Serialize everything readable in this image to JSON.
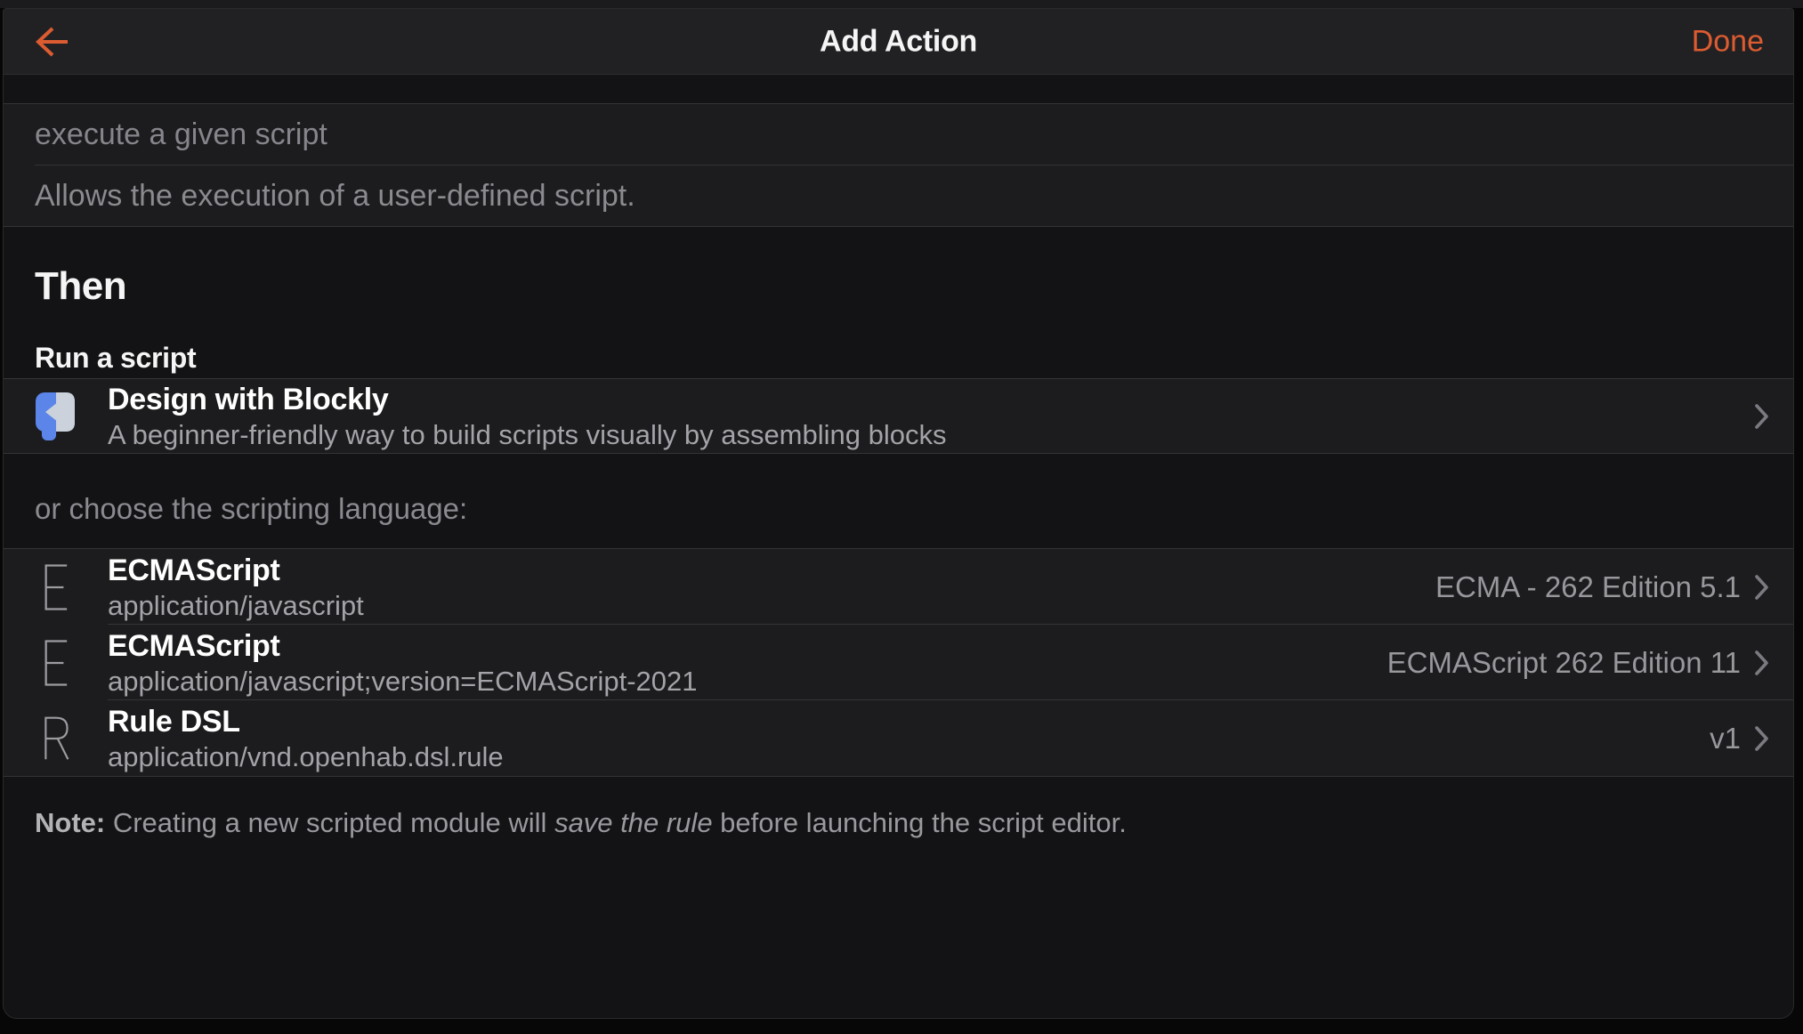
{
  "colors": {
    "accent": "#dc5c31",
    "popup_background": "#131315",
    "row_background": "#1c1c1e",
    "navbar_background": "#212123",
    "blockly_blue": "#5b85e8",
    "blockly_gray": "#ccd2db"
  },
  "navbar": {
    "title": "Add Action",
    "back_icon": "back-arrow",
    "done_label": "Done"
  },
  "search": {
    "query": "execute a given script",
    "description": "Allows the execution of a user-defined script."
  },
  "then_section": {
    "heading": "Then",
    "subheading": "Run a script"
  },
  "blockly_item": {
    "title": "Design with Blockly",
    "subtitle": "A beginner-friendly way to build scripts visually by assembling blocks"
  },
  "choose_label": "or choose the scripting language:",
  "languages": [
    {
      "letter": "E",
      "title": "ECMAScript",
      "subtitle": "application/javascript",
      "version": "ECMA - 262 Edition 5.1"
    },
    {
      "letter": "E",
      "title": "ECMAScript",
      "subtitle": "application/javascript;version=ECMAScript-2021",
      "version": "ECMAScript 262 Edition 11"
    },
    {
      "letter": "R",
      "title": "Rule DSL",
      "subtitle": "application/vnd.openhab.dsl.rule",
      "version": "v1"
    }
  ],
  "note": {
    "label": "Note:",
    "before": " Creating a new scripted module will ",
    "italic": "save the rule",
    "after": " before launching the script editor."
  }
}
